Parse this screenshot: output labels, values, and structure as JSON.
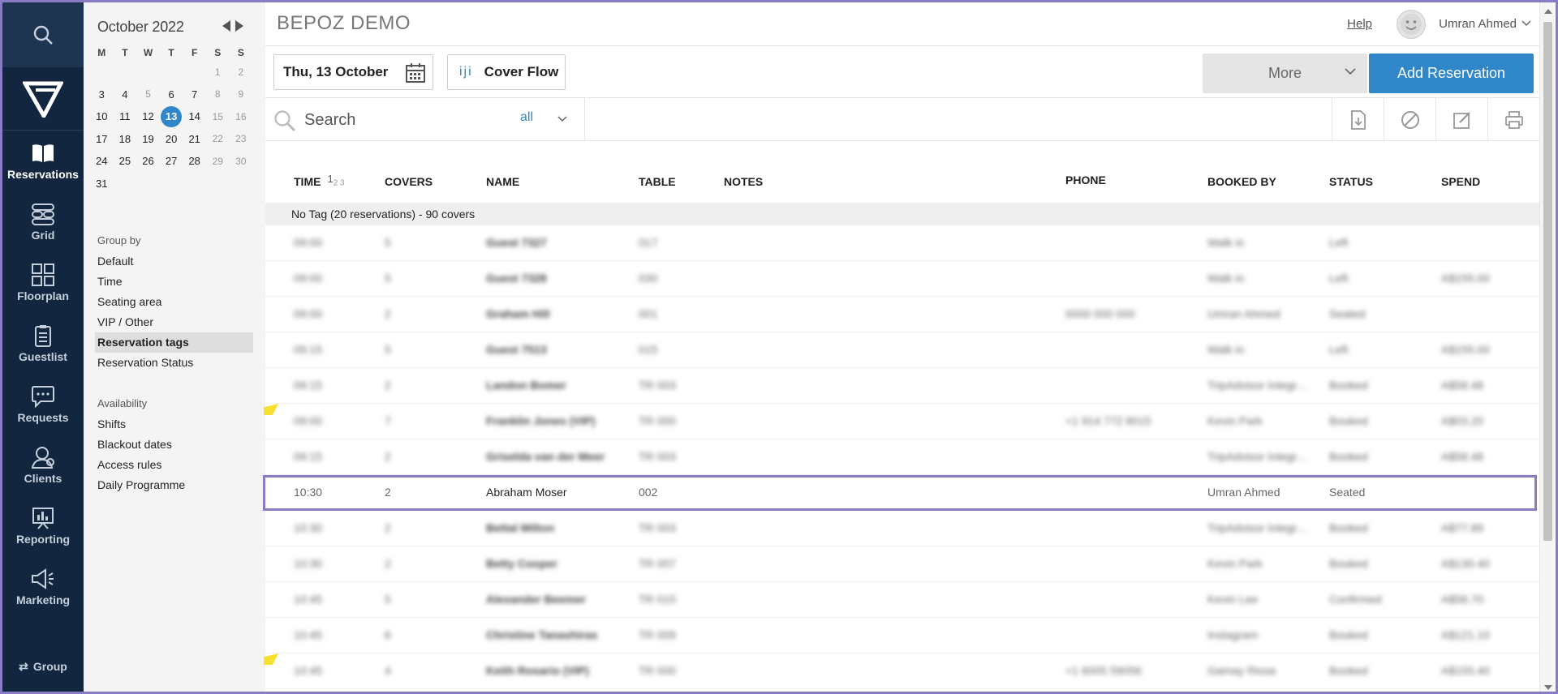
{
  "nav": {
    "search_icon": "search-icon",
    "items": [
      {
        "label": "Reservations",
        "icon": "book-icon",
        "active": true
      },
      {
        "label": "Grid",
        "icon": "grid-icon"
      },
      {
        "label": "Floorplan",
        "icon": "floorplan-icon"
      },
      {
        "label": "Guestlist",
        "icon": "clipboard-icon"
      },
      {
        "label": "Requests",
        "icon": "chat-icon"
      },
      {
        "label": "Clients",
        "icon": "clients-icon"
      },
      {
        "label": "Reporting",
        "icon": "chart-icon"
      },
      {
        "label": "Marketing",
        "icon": "megaphone-icon"
      }
    ],
    "group_label": "Group"
  },
  "calendar": {
    "month": "October 2022",
    "dow": [
      "M",
      "T",
      "W",
      "T",
      "F",
      "S",
      "S"
    ],
    "weeks": [
      [
        "",
        "",
        "",
        "",
        "",
        "1",
        "2"
      ],
      [
        "3",
        "4",
        "5",
        "6",
        "7",
        "8",
        "9"
      ],
      [
        "10",
        "11",
        "12",
        "13",
        "14",
        "15",
        "16"
      ],
      [
        "17",
        "18",
        "19",
        "20",
        "21",
        "22",
        "23"
      ],
      [
        "24",
        "25",
        "26",
        "27",
        "28",
        "29",
        "30"
      ],
      [
        "31",
        "",
        "",
        "",
        "",
        "",
        ""
      ]
    ],
    "selected": "13"
  },
  "group_by": {
    "title": "Group by",
    "items": [
      "Default",
      "Time",
      "Seating area",
      "VIP / Other",
      "Reservation tags",
      "Reservation Status"
    ],
    "active": "Reservation tags"
  },
  "availability": {
    "title": "Availability",
    "items": [
      "Shifts",
      "Blackout dates",
      "Access rules",
      "Daily Programme"
    ]
  },
  "header": {
    "brand": "BEPOZ DEMO",
    "help": "Help",
    "user": "Umran Ahmed"
  },
  "toolbar": {
    "date": "Thu, 13 October",
    "cover_flow": "Cover Flow",
    "cover_flow_icon": "iji",
    "more": "More",
    "add": "Add Reservation"
  },
  "search": {
    "placeholder": "Search",
    "filter": "all"
  },
  "table": {
    "headers": {
      "time": "TIME",
      "covers": "COVERS",
      "name": "NAME",
      "table": "TABLE",
      "notes": "NOTES",
      "phone": "PHONE",
      "booked_by": "BOOKED BY",
      "status": "STATUS",
      "spend": "SPEND"
    },
    "sort_icon": "1",
    "sort_sub": "2 3",
    "group_label": "No Tag (20 reservations) - 90 covers",
    "rows": [
      {
        "time": "09:00",
        "covers": "5",
        "name": "Guest 7327",
        "table": "017",
        "phone": "",
        "booked_by": "Walk in",
        "status": "Left",
        "spend": "",
        "blur": true
      },
      {
        "time": "09:00",
        "covers": "5",
        "name": "Guest 7328",
        "table": "030",
        "phone": "",
        "booked_by": "Walk in",
        "status": "Left",
        "spend": "A$155.00",
        "blur": true
      },
      {
        "time": "09:00",
        "covers": "2",
        "name": "Graham Hill",
        "table": "001",
        "phone": "0000 000 000",
        "booked_by": "Umran Ahmed",
        "status": "Seated",
        "spend": "",
        "blur": true
      },
      {
        "time": "09:15",
        "covers": "5",
        "name": "Guest 7513",
        "table": "015",
        "phone": "",
        "booked_by": "Walk in",
        "status": "Left",
        "spend": "A$155.00",
        "blur": true
      },
      {
        "time": "09:15",
        "covers": "2",
        "name": "Landon Bomer",
        "table": "TR 003",
        "phone": "",
        "booked_by": "TripAdvisor Integr...",
        "status": "Booked",
        "spend": "A$58.48",
        "blur": true
      },
      {
        "time": "09:00",
        "covers": "7",
        "name": "Franklin Jones (VIP)",
        "table": "TR 000",
        "phone": "+1 914 772 8015",
        "booked_by": "Kevin Park",
        "status": "Booked",
        "spend": "A$03.20",
        "blur": true,
        "flag": true
      },
      {
        "time": "09:15",
        "covers": "2",
        "name": "Griselda van der Meer",
        "table": "TR 003",
        "phone": "",
        "booked_by": "TripAdvisor Integr...",
        "status": "Booked",
        "spend": "A$58.48",
        "blur": true
      },
      {
        "time": "10:30",
        "covers": "2",
        "name": "Abraham Moser",
        "table": "002",
        "phone": "",
        "booked_by": "Umran Ahmed",
        "status": "Seated",
        "spend": "",
        "highlight": true
      },
      {
        "time": "10:30",
        "covers": "2",
        "name": "Bettal Milton",
        "table": "TR 003",
        "phone": "",
        "booked_by": "TripAdvisor Integr...",
        "status": "Booked",
        "spend": "A$77.89",
        "blur": true
      },
      {
        "time": "10:30",
        "covers": "2",
        "name": "Betty Cooper",
        "table": "TR 007",
        "phone": "",
        "booked_by": "Kevin Park",
        "status": "Booked",
        "spend": "A$130.40",
        "blur": true
      },
      {
        "time": "10:45",
        "covers": "5",
        "name": "Alexander Beemer",
        "table": "TR 015",
        "phone": "",
        "booked_by": "Kevin Lee",
        "status": "Confirmed",
        "spend": "A$58.70",
        "blur": true
      },
      {
        "time": "10:45",
        "covers": "6",
        "name": "Christine Tanashiras",
        "table": "TR 009",
        "phone": "",
        "booked_by": "Instagram",
        "status": "Booked",
        "spend": "A$121.10",
        "blur": true
      },
      {
        "time": "10:45",
        "covers": "4",
        "name": "Keith Rosario (VIP)",
        "table": "TR 000",
        "phone": "+1 6005 59056",
        "booked_by": "Gamay Rissa",
        "status": "Booked",
        "spend": "A$155.40",
        "blur": true,
        "flag": true
      }
    ]
  }
}
